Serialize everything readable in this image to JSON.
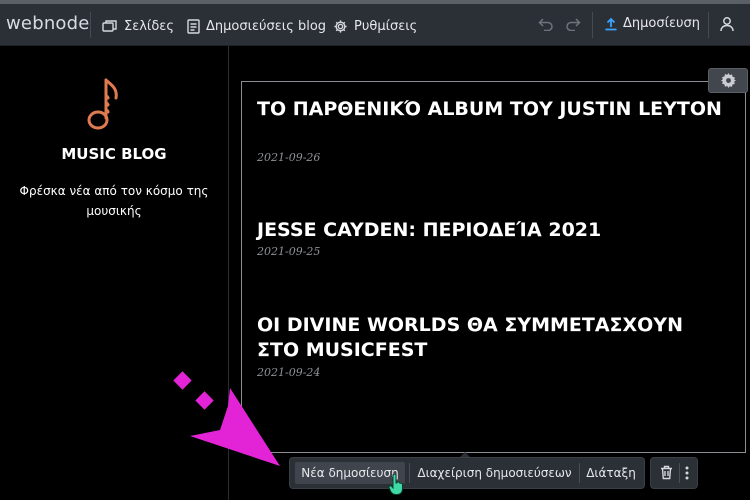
{
  "topbar": {
    "logo": "webnode",
    "pages_label": "Σελίδες",
    "blog_posts_label": "Δημοσιεύσεις blog",
    "settings_label": "Ρυθμίσεις",
    "publish_label": "Δημοσίευση"
  },
  "sidebar": {
    "title": "MUSIC BLOG",
    "tagline": "Φρέσκα νέα από τον κόσμο της μουσικής"
  },
  "posts": [
    {
      "title": "ΤΟ ΠΑΡΘΕΝΙΚΌ ALBUM ΤΟΥ JUSTIN LEYTON",
      "date": "2021-09-26"
    },
    {
      "title": "JESSE CAYDEN: ΠΕΡΙΟΔΕΊΑ 2021",
      "date": "2021-09-25"
    },
    {
      "title": "ΟΙ DIVINE WORLDS ΘΑ ΣΥΜΜΕΤΑΣΧΟΥΝ ΣΤΟ MUSICFEST",
      "date": "2021-09-24"
    }
  ],
  "toolbar": {
    "new_post_label": "Νέα δημοσίευση",
    "manage_posts_label": "Διαχείριση δημοσιεύσεων",
    "layout_label": "Διάταξη"
  },
  "colors": {
    "topbar_bg": "#2b2f36",
    "accent_blue": "#3aa3ff",
    "brand_orange": "#e07a50",
    "annotation_magenta": "#e224d6"
  },
  "icons": {
    "pages": "pages-icon",
    "blog_posts": "document-icon",
    "settings": "gear-icon",
    "undo": "undo-icon",
    "redo": "redo-icon",
    "publish": "upload-icon",
    "user": "user-icon",
    "music_note": "music-note-icon",
    "block_settings": "gear-icon",
    "delete": "trash-icon",
    "more": "more-vertical-icon",
    "cursor": "hand-pointer-icon",
    "annotation": "arrow-icon"
  }
}
